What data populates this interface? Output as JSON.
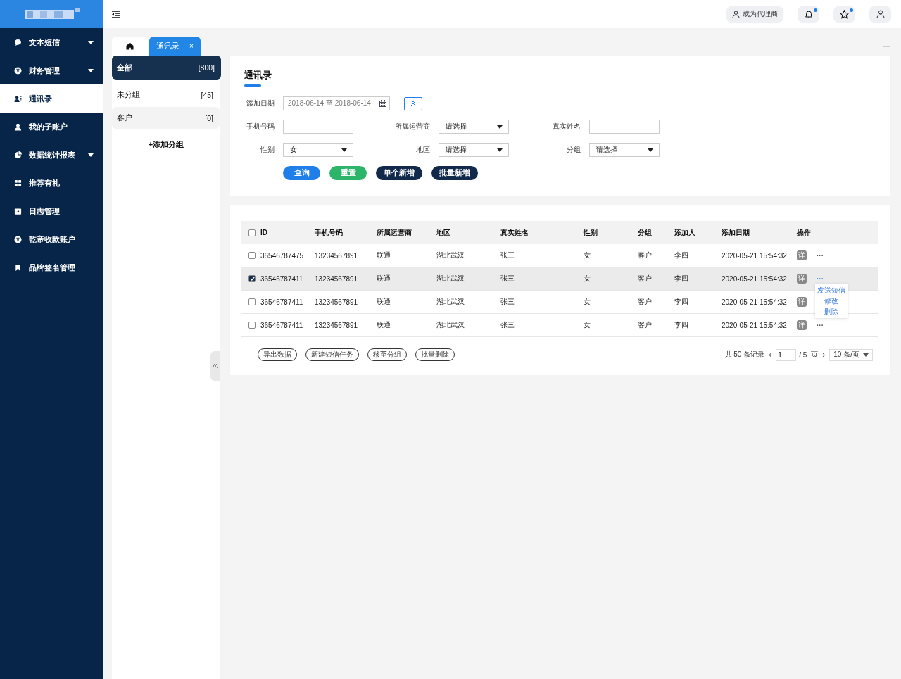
{
  "sidebar": {
    "items": [
      {
        "label": "文本短信",
        "has_submenu": true,
        "selected": false
      },
      {
        "label": "财务管理",
        "has_submenu": true,
        "selected": false
      },
      {
        "label": "通讯录",
        "has_submenu": false,
        "selected": true
      },
      {
        "label": "我的子账户",
        "has_submenu": false,
        "selected": false
      },
      {
        "label": "数据统计报表",
        "has_submenu": true,
        "selected": false
      },
      {
        "label": "推荐有礼",
        "has_submenu": false,
        "selected": false
      },
      {
        "label": "日志管理",
        "has_submenu": false,
        "selected": false
      },
      {
        "label": "乾帝收款账户",
        "has_submenu": false,
        "selected": false
      },
      {
        "label": "品牌签名管理",
        "has_submenu": false,
        "selected": false
      }
    ]
  },
  "header": {
    "agent_button": "成为代理商",
    "bell_dot": true,
    "star_dot": true
  },
  "tabs": [
    {
      "kind": "home",
      "selected": false
    },
    {
      "kind": "page",
      "label": "通讯录",
      "close": "×",
      "selected": true
    }
  ],
  "groups": {
    "items": [
      {
        "name": "全部",
        "count": "[800]",
        "selected": true,
        "hovered": false
      },
      {
        "name": "未分组",
        "count": "[45]",
        "selected": false,
        "hovered": false
      },
      {
        "name": "客户",
        "count": "[0]",
        "selected": false,
        "hovered": true
      }
    ],
    "add": "+添加分组"
  },
  "filter": {
    "title": "通讯录",
    "date": {
      "label": "添加日期",
      "value": "2018-06-14 至 2018-06-14"
    },
    "fields": [
      {
        "kind": "input",
        "label": "手机号码"
      },
      {
        "kind": "select",
        "label": "所属运营商",
        "value": "请选择"
      },
      {
        "kind": "input",
        "label": "真实姓名"
      },
      {
        "kind": "select",
        "label": "性别",
        "value": "女"
      },
      {
        "kind": "select",
        "label": "地区",
        "value": "请选择"
      },
      {
        "kind": "select",
        "label": "分组",
        "value": "请选择"
      }
    ],
    "buttons": [
      {
        "label": "查询",
        "color": "#1f7ee8"
      },
      {
        "label": "重置",
        "color": "#2bb46a"
      },
      {
        "label": "单个新增",
        "color": "#11294a"
      },
      {
        "label": "批量新增",
        "color": "#11294a"
      }
    ]
  },
  "table": {
    "columns": [
      "ID",
      "手机号码",
      "所属运营商",
      "地区",
      "真实姓名",
      "性别",
      "分组",
      "添加人",
      "添加日期",
      "操作"
    ],
    "header_checked": false,
    "rows": [
      {
        "cells": [
          "36546787475",
          "13234567891",
          "联通",
          "湖北武汉",
          "张三",
          "女",
          "客户",
          "李四",
          "2020-05-21 15:54:32"
        ],
        "detail": "详",
        "more": "···",
        "checked": false,
        "selected": false,
        "menu_open": false
      },
      {
        "cells": [
          "36546787411",
          "13234567891",
          "联通",
          "湖北武汉",
          "张三",
          "女",
          "客户",
          "李四",
          "2020-05-21 15:54:32"
        ],
        "detail": "详",
        "more": "···",
        "checked": true,
        "selected": true,
        "menu_open": true
      },
      {
        "cells": [
          "36546787411",
          "13234567891",
          "联通",
          "湖北武汉",
          "张三",
          "女",
          "客户",
          "李四",
          "2020-05-21 15:54:32"
        ],
        "detail": "详",
        "checked": false,
        "selected": false,
        "menu_open": false
      },
      {
        "cells": [
          "36546787411",
          "13234567891",
          "联通",
          "湖北武汉",
          "张三",
          "女",
          "客户",
          "李四",
          "2020-05-21 15:54:32"
        ],
        "detail": "详",
        "more": "···",
        "checked": false,
        "selected": false,
        "menu_open": false
      }
    ],
    "row_menu": [
      "发送短信",
      "修改",
      "删除"
    ],
    "actions": [
      "导出数据",
      "新建短信任务",
      "移至分组",
      "批量删除"
    ],
    "pagination": {
      "total": "共 50 条记录",
      "prev": "‹",
      "page": "1",
      "of": "/ 5",
      "page_label": "页",
      "next": "›",
      "page_size": "10 条/页"
    }
  }
}
